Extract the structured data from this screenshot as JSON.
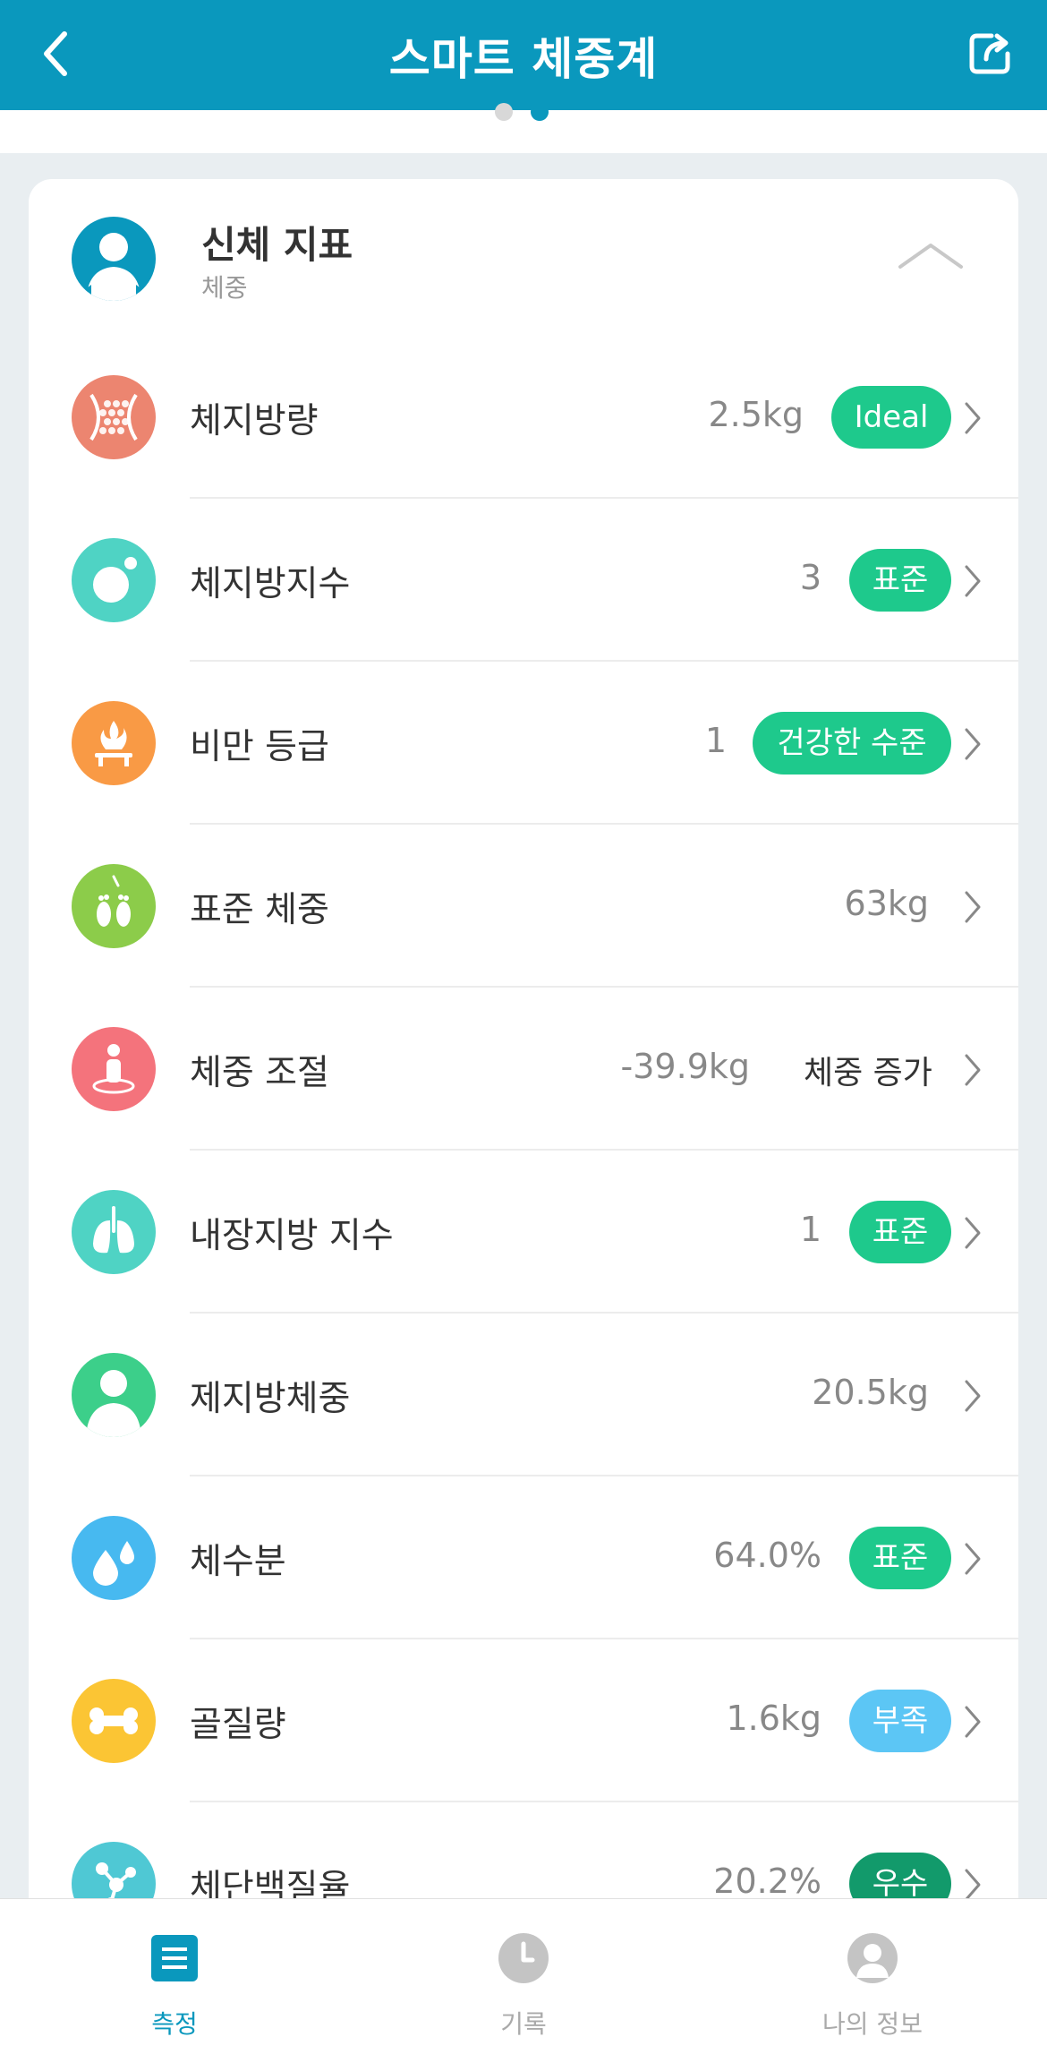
{
  "header": {
    "title": "스마트 체중계",
    "back_icon": "chevron-left-icon",
    "share_icon": "share-icon"
  },
  "pager": {
    "total": 2,
    "active": 2
  },
  "section": {
    "title": "신체 지표",
    "subtitle": "체중",
    "expanded": true
  },
  "colors": {
    "brand": "#0a98bd",
    "green": "#1ec98c",
    "blue": "#5cc6f5",
    "dark_green": "#129a6b"
  },
  "rows": [
    {
      "label": "체지방량",
      "value": "2.5kg",
      "badge": "Ideal",
      "icon": "body-fat-icon"
    },
    {
      "label": "체지방지수",
      "value": "3",
      "badge": "표준",
      "icon": "fat-index-icon"
    },
    {
      "label": "비만 등급",
      "value": "1",
      "badge": "건강한 수준",
      "icon": "obesity-grade-icon"
    },
    {
      "label": "표준 체중",
      "value": "63kg",
      "icon": "standard-weight-icon"
    },
    {
      "label": "체중 조절",
      "value": "-39.9kg",
      "status": "체중 증가",
      "icon": "weight-control-icon"
    },
    {
      "label": "내장지방 지수",
      "value": "1",
      "badge": "표준",
      "icon": "visceral-fat-icon"
    },
    {
      "label": "제지방체중",
      "value": "20.5kg",
      "icon": "lean-body-mass-icon"
    },
    {
      "label": "체수분",
      "value": "64.0%",
      "badge": "표준",
      "icon": "body-water-icon"
    },
    {
      "label": "골질량",
      "value": "1.6kg",
      "badge": "부족",
      "icon": "bone-mass-icon"
    },
    {
      "label": "체단백질율",
      "value": "20.2%",
      "badge": "우수",
      "icon": "protein-icon"
    }
  ],
  "tabbar": {
    "tabs": [
      {
        "label": "측정",
        "icon": "measure-icon",
        "active": true
      },
      {
        "label": "기록",
        "icon": "history-clock-icon",
        "active": false
      },
      {
        "label": "나의 정보",
        "icon": "profile-icon",
        "active": false
      }
    ]
  }
}
